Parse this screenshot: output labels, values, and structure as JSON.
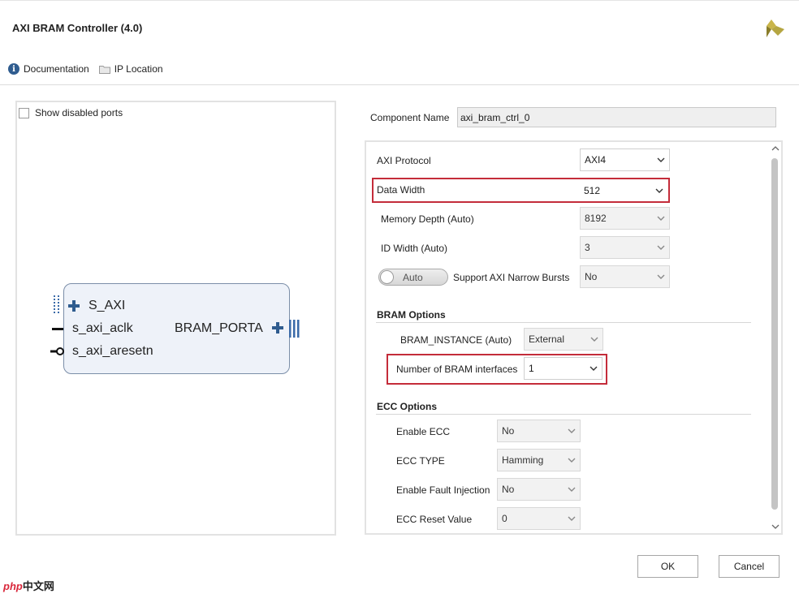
{
  "window": {
    "title": "AXI BRAM Controller (4.0)"
  },
  "toplinks": {
    "documentation": "Documentation",
    "ip_location": "IP Location"
  },
  "left": {
    "show_disabled_ports": "Show disabled ports",
    "symbol": {
      "port_s_axi": "S_AXI",
      "port_aclk": "s_axi_aclk",
      "port_aresetn": "s_axi_aresetn",
      "port_bram": "BRAM_PORTA"
    }
  },
  "component": {
    "label": "Component Name",
    "value": "axi_bram_ctrl_0"
  },
  "params": {
    "axi_protocol": {
      "label": "AXI Protocol",
      "value": "AXI4"
    },
    "data_width": {
      "label": "Data Width",
      "value": "512"
    },
    "memory_depth": {
      "label": "Memory Depth (Auto)",
      "value": "8192"
    },
    "id_width": {
      "label": "ID Width (Auto)",
      "value": "3"
    },
    "narrow_bursts": {
      "toggle": "Auto",
      "label": "Support AXI Narrow Bursts",
      "value": "No"
    }
  },
  "bram_options": {
    "heading": "BRAM Options",
    "instance": {
      "label": "BRAM_INSTANCE (Auto)",
      "value": "External"
    },
    "num_interfaces": {
      "label": "Number of BRAM interfaces",
      "value": "1"
    }
  },
  "ecc_options": {
    "heading": "ECC Options",
    "enable_ecc": {
      "label": "Enable ECC",
      "value": "No"
    },
    "ecc_type": {
      "label": "ECC TYPE",
      "value": "Hamming"
    },
    "fault_injection": {
      "label": "Enable Fault Injection",
      "value": "No"
    },
    "reset_value": {
      "label": "ECC Reset Value",
      "value": "0"
    }
  },
  "buttons": {
    "ok": "OK",
    "cancel": "Cancel"
  },
  "watermark": {
    "php": "php",
    "site": "中文网"
  },
  "colors": {
    "highlight": "#c42c3a",
    "icon_blue": "#2f5c8f",
    "logo_gold": "#b5a642"
  }
}
